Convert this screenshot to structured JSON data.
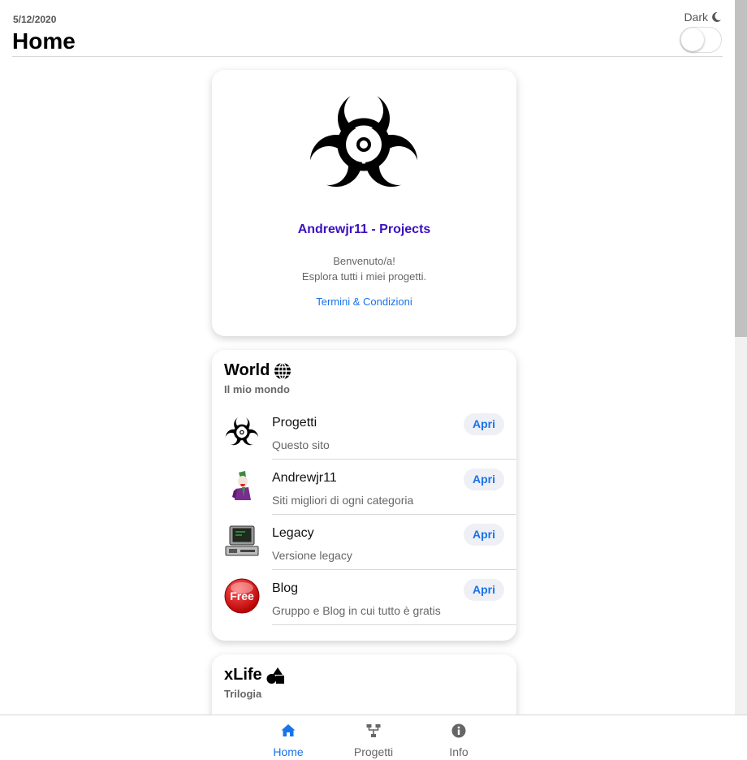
{
  "header": {
    "date": "5/12/2020",
    "title": "Home",
    "dark_label": "Dark",
    "dark_mode_on": false
  },
  "profile": {
    "name": "Andrewjr11 - Projects",
    "welcome_line1": "Benvenuto/a!",
    "welcome_line2": "Esplora tutti i miei progetti.",
    "terms_link": "Termini & Condizioni"
  },
  "world": {
    "title": "World",
    "subtitle": "Il mio mondo",
    "items": [
      {
        "name": "Progetti",
        "desc": "Questo sito",
        "button": "Apri",
        "icon": "biohazard-icon"
      },
      {
        "name": "Andrewjr11",
        "desc": "Siti migliori di ogni categoria",
        "button": "Apri",
        "icon": "joker-avatar-icon"
      },
      {
        "name": "Legacy",
        "desc": "Versione legacy",
        "button": "Apri",
        "icon": "retro-computer-icon"
      },
      {
        "name": "Blog",
        "desc": "Gruppo e Blog in cui tutto è gratis",
        "button": "Apri",
        "icon": "free-badge-icon"
      }
    ],
    "free_badge_text": "Free"
  },
  "xlife": {
    "title": "xLife",
    "subtitle": "Trilogia"
  },
  "tabs": [
    {
      "label": "Home",
      "icon": "home-icon",
      "active": true
    },
    {
      "label": "Progetti",
      "icon": "sitemap-icon",
      "active": false
    },
    {
      "label": "Info",
      "icon": "info-icon",
      "active": false
    }
  ],
  "colors": {
    "accent": "#1a73e8",
    "profile_name": "#3b0fbf",
    "button_bg": "#eef0f5",
    "free_badge": "#d40000"
  }
}
